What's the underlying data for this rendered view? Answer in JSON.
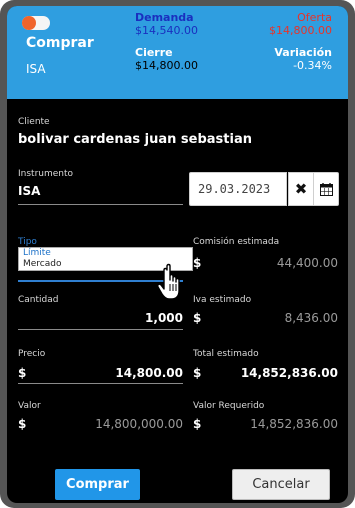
{
  "header": {
    "mode_label": "Comprar",
    "symbol": "ISA",
    "demand_label": "Demanda",
    "demand_value": "$14,540.00",
    "offer_label": "Oferta",
    "offer_value": "$14,800.00",
    "close_label": "Cierre",
    "close_value": "$14,800.00",
    "variation_label": "Variación",
    "variation_value": "-0.34%"
  },
  "form": {
    "client_label": "Cliente",
    "client_value": "bolivar cardenas juan sebastian",
    "instrument_label": "Instrumento",
    "instrument_value": "ISA",
    "date_value": "29.03.2023",
    "type_label": "Tipo",
    "type_options": [
      "Límite",
      "Mercado"
    ],
    "commission_label": "Comisión estimada",
    "commission_value": "44,400.00",
    "quantity_label": "Cantidad",
    "quantity_value": "1,000",
    "iva_label": "Iva estimado",
    "iva_value": "8,436.00",
    "price_label": "Precio",
    "price_value": "14,800.00",
    "total_label": "Total estimado",
    "total_value": "14,852,836.00",
    "value_label": "Valor",
    "value_value": "14,800,000.00",
    "required_label": "Valor Requerido",
    "required_value": "14,852,836.00",
    "currency": "$"
  },
  "actions": {
    "buy_label": "Comprar",
    "cancel_label": "Cancelar"
  },
  "colors": {
    "header_bg": "#2f9ee0",
    "demand": "#1a2fbf",
    "offer": "#e8332a",
    "primary_button": "#2196e8"
  }
}
